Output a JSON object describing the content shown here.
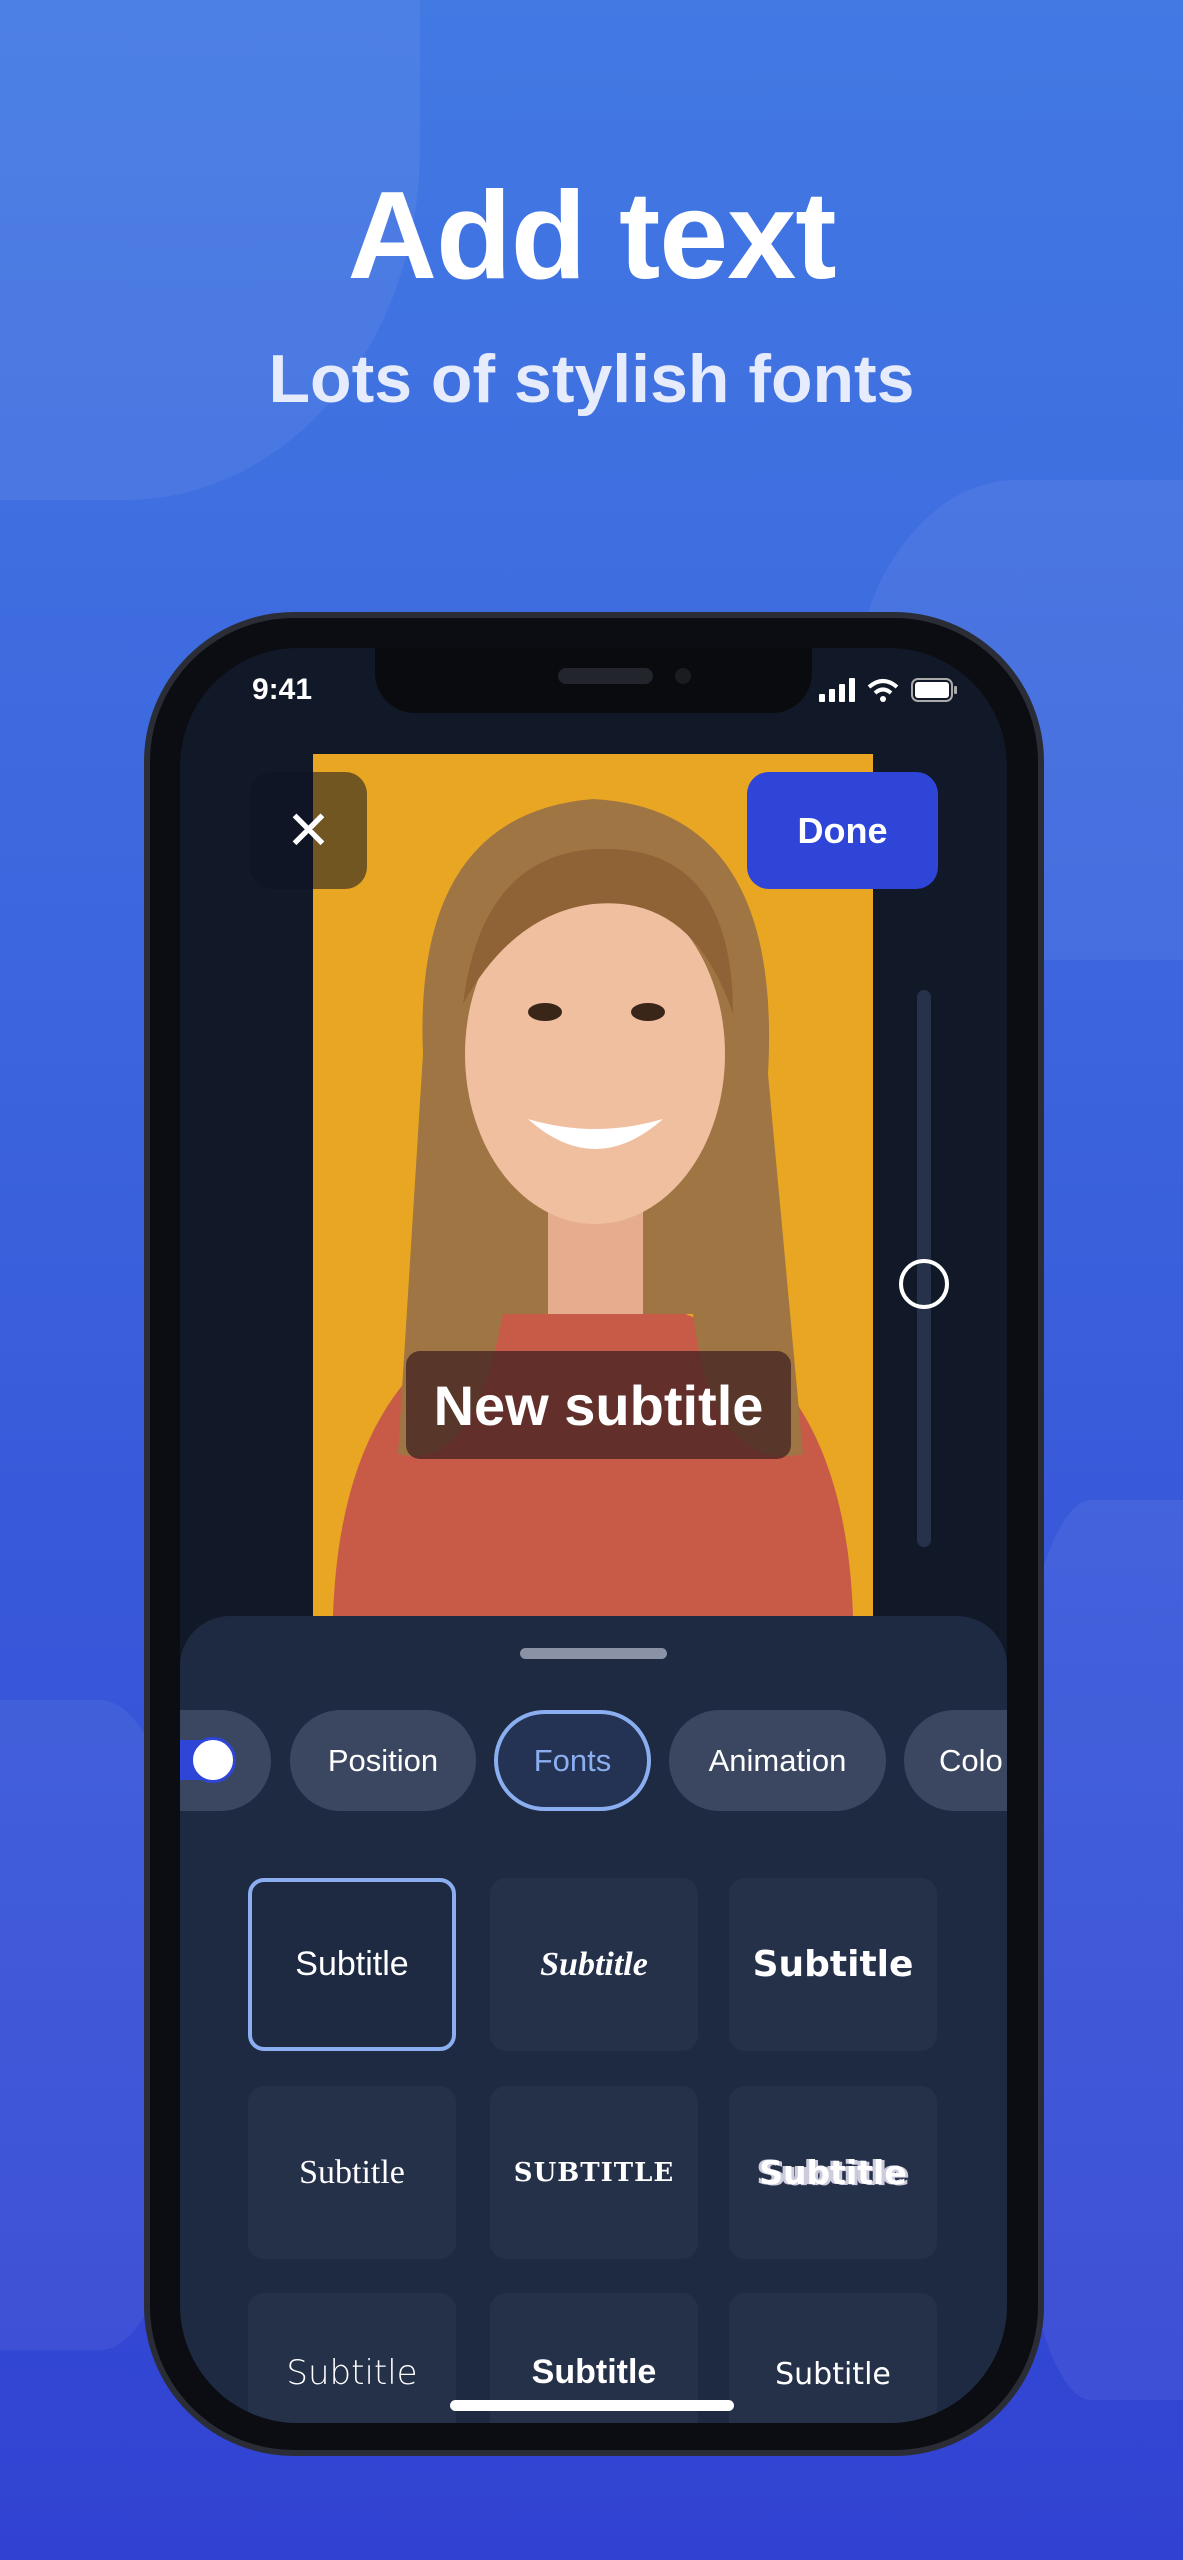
{
  "hero": {
    "title": "Add text",
    "subtitle": "Lots of stylish fonts"
  },
  "status_bar": {
    "time": "9:41",
    "icons": [
      "signal-icon",
      "wifi-icon",
      "battery-icon"
    ]
  },
  "editor": {
    "close_icon": "close-icon",
    "done_label": "Done",
    "caption_text": "New subtitle",
    "text_size_slider_value": 0.5
  },
  "tabs": [
    {
      "label": "Position"
    },
    {
      "label": "Fonts",
      "active": true
    },
    {
      "label": "Animation"
    },
    {
      "label": "Colo"
    }
  ],
  "fonts": [
    {
      "label": "Subtitle",
      "selected": true
    },
    {
      "label": "Subtitle"
    },
    {
      "label": "Subtitle"
    },
    {
      "label": "Subtitle"
    },
    {
      "label": "SUBTITLE"
    },
    {
      "label": "Subtitle"
    },
    {
      "label": "Subtitle"
    },
    {
      "label": "Subtitle"
    },
    {
      "label": "Subtitle"
    }
  ],
  "colors": {
    "accent": "#2e45d8",
    "selected_outline": "#8aaef0",
    "photo_bg": "#e8a623",
    "sheet": "#1e2a42"
  }
}
